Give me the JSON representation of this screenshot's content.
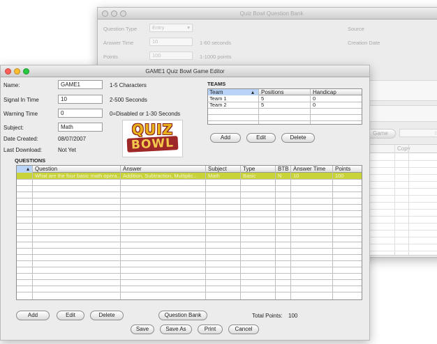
{
  "back_window": {
    "title": "Quiz Bowl Question Bank",
    "question_type_label": "Question Type",
    "question_type_value": "Entry",
    "answer_time_label": "Answer Time",
    "answer_time_value": "10",
    "answer_time_hint": "1-60 seconds",
    "points_label": "Points",
    "points_value": "100",
    "points_hint": "1-1000 points",
    "source_label": "Source",
    "creation_date_label": "Creation Date",
    "combo_label": "Game",
    "copy_header": "Copy"
  },
  "editor": {
    "title": "GAME1 Quiz Bowl Game Editor",
    "name_label": "Name:",
    "name_value": "GAME1",
    "name_hint": "1-5 Characters",
    "signal_label": "Signal In Time",
    "signal_value": "10",
    "signal_hint": "2-500 Seconds",
    "warning_label": "Warning Time",
    "warning_value": "0",
    "warning_hint": "0=Disabled or 1-30 Seconds",
    "subject_label": "Subject:",
    "subject_value": "Math",
    "date_created_label": "Date Created:",
    "date_created_value": "08/07/2007",
    "last_download_label": "Last Download:",
    "last_download_value": "Not Yet",
    "logo_line1": "QUIZ",
    "logo_line2": "BOWL"
  },
  "teams": {
    "heading": "TEAMS",
    "columns": [
      "Team",
      "Positions",
      "Handicap"
    ],
    "rows": [
      [
        "Team 1",
        "5",
        "0"
      ],
      [
        "Team 2",
        "5",
        "0"
      ]
    ],
    "add": "Add",
    "edit": "Edit",
    "delete": "Delete"
  },
  "questions": {
    "heading": "QUESTIONS",
    "columns": [
      "Question",
      "Answer",
      "Subject",
      "Type",
      "BTB",
      "Answer Time",
      "Points"
    ],
    "selected_row": [
      "What are the four basic math opera...",
      "Addition, Subtraction, Multiplic...",
      "Math",
      "Basic",
      "N",
      "10",
      "100"
    ]
  },
  "bottom": {
    "add": "Add",
    "edit": "Edit",
    "delete": "Delete",
    "question_bank": "Question Bank",
    "total_points_label": "Total Points:",
    "total_points_value": "100",
    "save": "Save",
    "save_as": "Save As",
    "print": "Print",
    "cancel": "Cancel"
  },
  "colors": {
    "selected_row": "#c8d33a",
    "title_red": "#ff5f57",
    "title_yellow": "#febc2e",
    "title_green": "#28c840",
    "selection_blue": "#b8d3f5"
  }
}
